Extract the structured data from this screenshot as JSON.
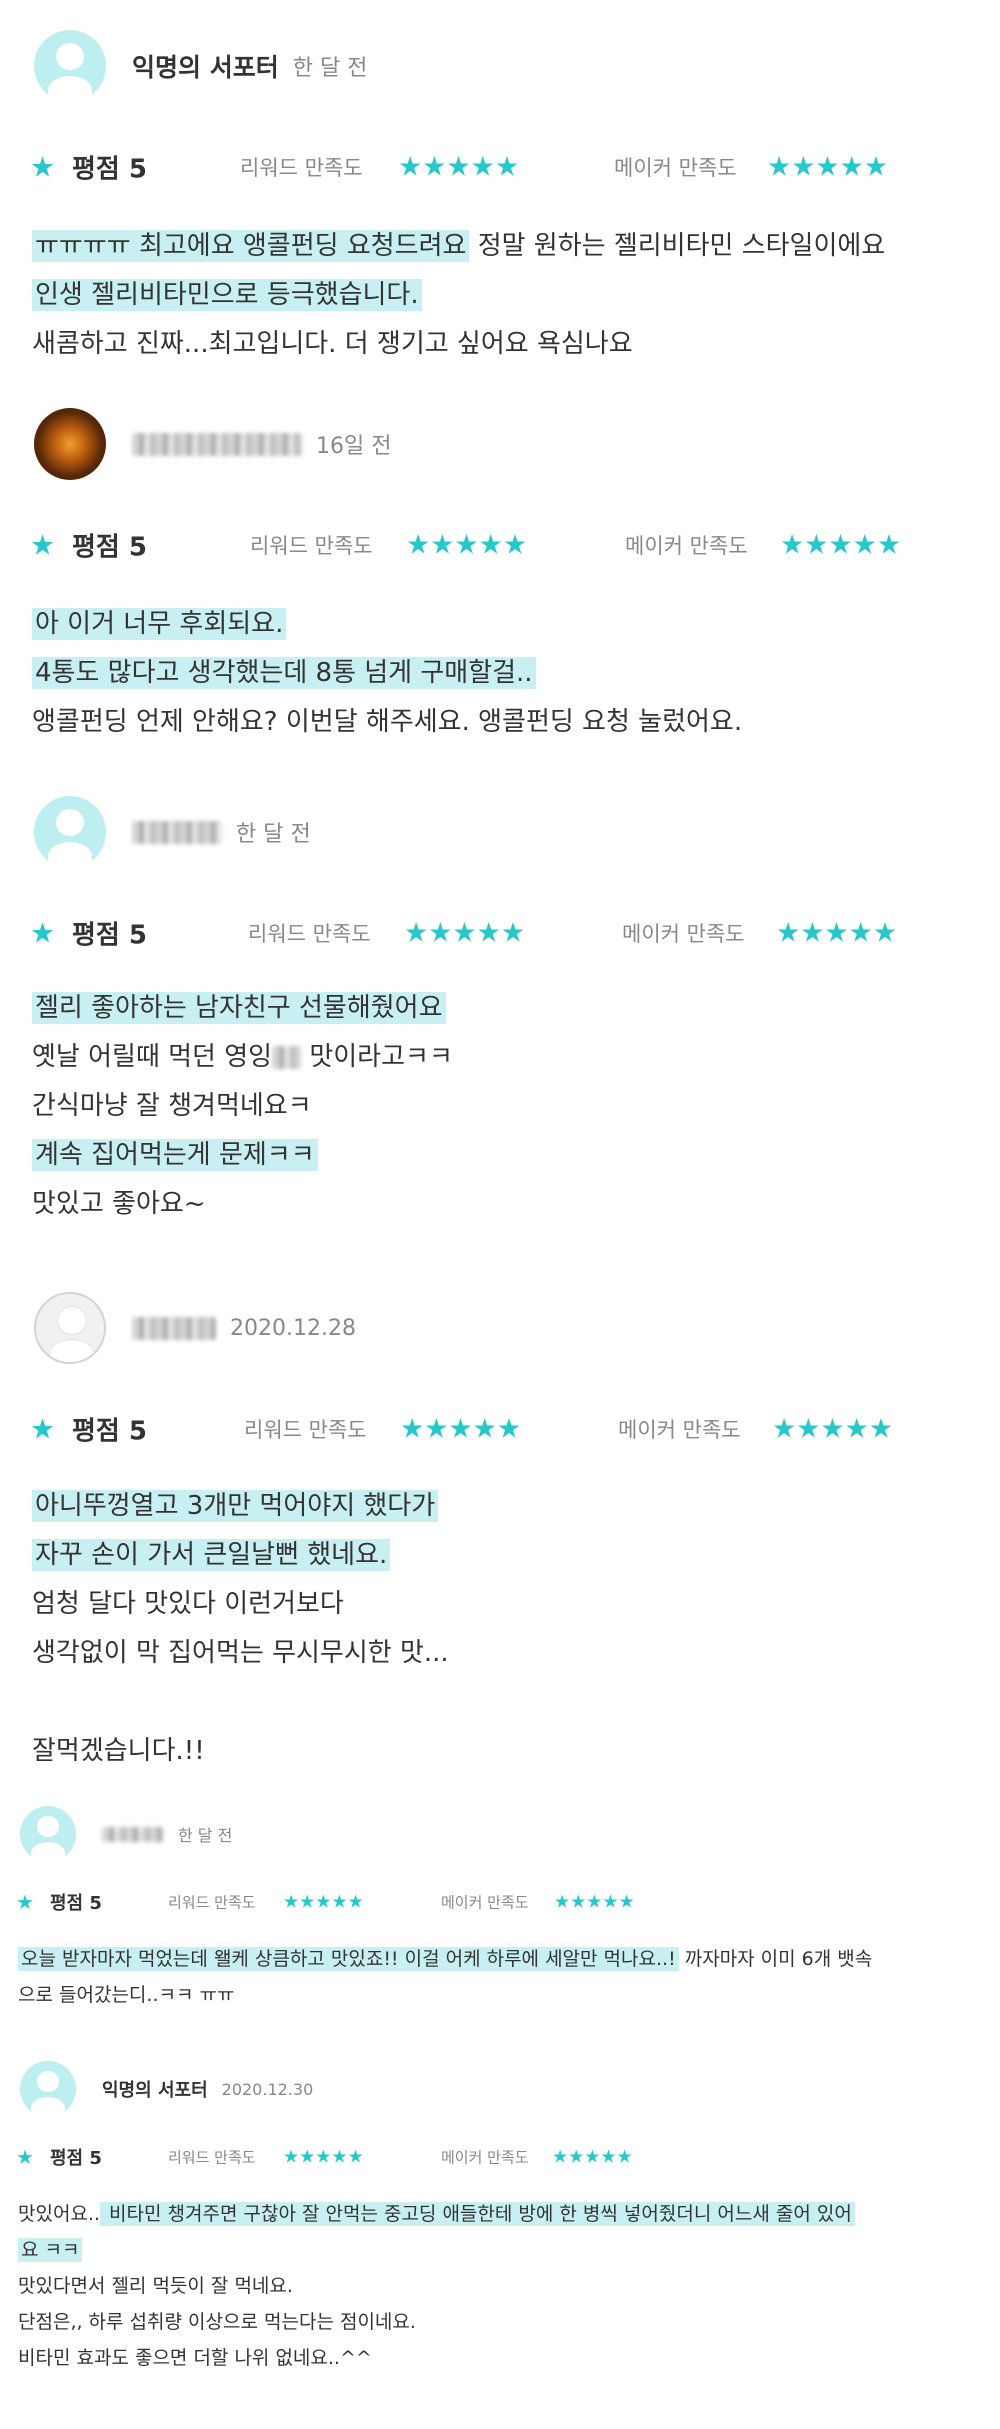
{
  "common": {
    "star_glyph": "★",
    "stars_five": "★★★★★",
    "score_label": "평점 5",
    "reward_label": "리워드 만족도",
    "maker_label": "메이커 만족도",
    "accent_color": "#27c8cc",
    "highlight_color": "#c8f0f2"
  },
  "reviews": [
    {
      "author": "익명의 서포터",
      "avatar": "default-avatar-icon",
      "date": "한 달 전",
      "lines": [
        {
          "parts": [
            {
              "text": "ㅠㅠㅠㅠ 최고에요 앵콜펀딩 요청드려요",
              "hl": true
            },
            {
              "text": " 정말 원하는 젤리비타민 스타일이에요",
              "hl": false
            }
          ]
        },
        {
          "parts": [
            {
              "text": "인생 젤리비타민으로 등극했습니다.",
              "hl": true
            }
          ]
        },
        {
          "parts": [
            {
              "text": "새콤하고 진짜...최고입니다. 더 쟁기고 싶어요 욕심나요",
              "hl": false
            }
          ]
        }
      ]
    },
    {
      "author": "",
      "avatar": "photo-avatar",
      "date": "16일 전",
      "lines": [
        {
          "parts": [
            {
              "text": "아 이거 너무 후회되요.",
              "hl": true
            }
          ]
        },
        {
          "parts": [
            {
              "text": "4통도 많다고 생각했는데 8통 넘게 구매할걸..",
              "hl": true
            }
          ]
        },
        {
          "parts": [
            {
              "text": "앵콜펀딩 언제 안해요? 이번달 해주세요. 앵콜펀딩 요청 눌렀어요.",
              "hl": false
            }
          ]
        }
      ]
    },
    {
      "author": "",
      "avatar": "default-avatar-icon",
      "date": "한 달 전",
      "lines": [
        {
          "parts": [
            {
              "text": "젤리 좋아하는 남자친구 선물해줬어요",
              "hl": true
            }
          ]
        },
        {
          "parts": [
            {
              "text": "옛날 어릴때 먹던 영잉",
              "hl": false
            },
            {
              "text": "",
              "hl": false,
              "blur": true
            },
            {
              "text": " 맛이라고ㅋㅋ",
              "hl": false
            }
          ]
        },
        {
          "parts": [
            {
              "text": "간식마냥 잘 챙겨먹네요ㅋ",
              "hl": false
            }
          ]
        },
        {
          "parts": [
            {
              "text": "계속 집어먹는게 문제ㅋㅋ",
              "hl": true
            }
          ]
        },
        {
          "parts": [
            {
              "text": "맛있고 좋아요~",
              "hl": false
            }
          ]
        }
      ]
    },
    {
      "author": "",
      "avatar": "default-avatar-icon",
      "date": "2020.12.28",
      "lines": [
        {
          "parts": [
            {
              "text": "아니뚜껑열고 3개만 먹어야지 했다가",
              "hl": true
            }
          ]
        },
        {
          "parts": [
            {
              "text": "자꾸 손이 가서 큰일날뻔 했네요.",
              "hl": true
            }
          ]
        },
        {
          "parts": [
            {
              "text": "엄청 달다 맛있다 이런거보다",
              "hl": false
            }
          ]
        },
        {
          "parts": [
            {
              "text": "생각없이 막 집어먹는 무시무시한 맛...",
              "hl": false
            }
          ]
        },
        {
          "parts": [
            {
              "text": "",
              "hl": false
            }
          ]
        },
        {
          "parts": [
            {
              "text": "잘먹겠습니다.!!",
              "hl": false
            }
          ]
        }
      ]
    },
    {
      "author": "",
      "avatar": "default-avatar-icon",
      "date": "한 달 전",
      "lines": [
        {
          "parts": [
            {
              "text": "오늘 받자마자 먹었는데 왤케 상큼하고 맛있죠!! 이걸 어케 하루에 세알만 먹나요..!",
              "hl": true
            },
            {
              "text": " 까자마자 이미 6개 뱃속",
              "hl": false
            }
          ]
        },
        {
          "parts": [
            {
              "text": "으로 들어갔는디..ㅋㅋ ㅠㅠ",
              "hl": false
            }
          ]
        }
      ]
    },
    {
      "author": "익명의 서포터",
      "avatar": "default-avatar-icon",
      "date": "2020.12.30",
      "lines": [
        {
          "parts": [
            {
              "text": "맛있어요..",
              "hl": false
            },
            {
              "text": " 비타민 챙겨주면 구찮아 잘 안먹는 중고딩 애들한테 방에 한 병씩 넣어줬더니 어느새 줄어 있어",
              "hl": true
            }
          ]
        },
        {
          "parts": [
            {
              "text": "요 ㅋㅋ",
              "hl": true
            }
          ]
        },
        {
          "parts": [
            {
              "text": "맛있다면서 젤리 먹듯이 잘 먹네요.",
              "hl": false
            }
          ]
        },
        {
          "parts": [
            {
              "text": "단점은,, 하루 섭취량 이상으로 먹는다는 점이네요.",
              "hl": false
            }
          ]
        },
        {
          "parts": [
            {
              "text": "비타민 효과도 좋으면 더할 나위 없네요..^^",
              "hl": false
            }
          ]
        }
      ]
    }
  ]
}
